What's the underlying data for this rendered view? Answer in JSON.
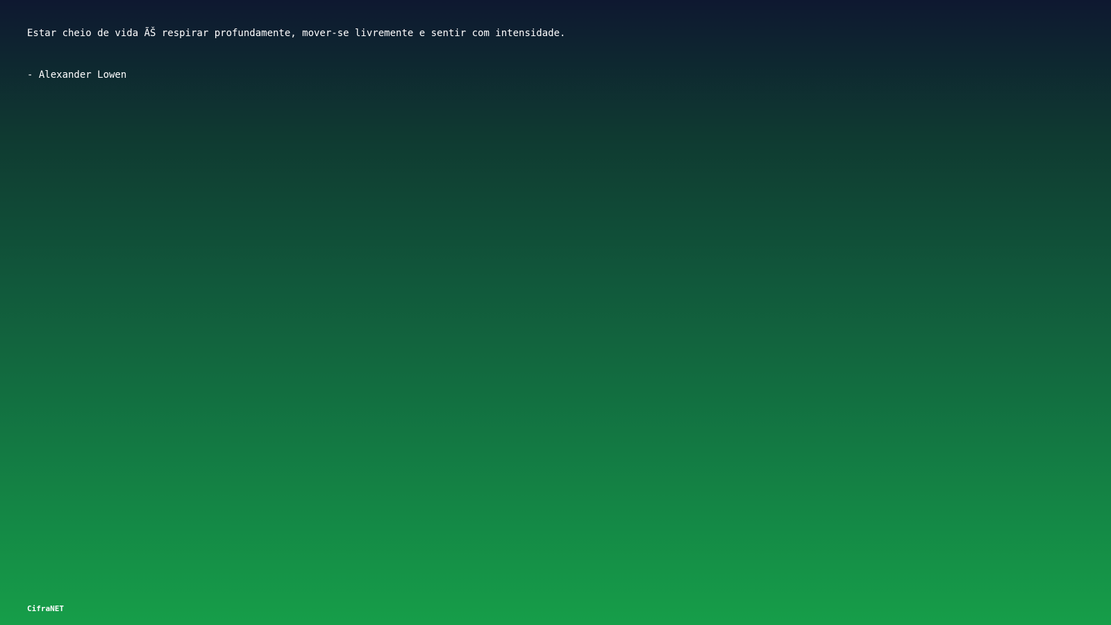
{
  "quote": {
    "text": "Estar cheio de vida ÃŠ respirar profundamente, mover-se livremente e sentir com intensidade.",
    "author": "- Alexander Lowen"
  },
  "brand": {
    "label": "CifraNET"
  },
  "colors": {
    "gradient_top": "#0e1830",
    "gradient_bottom": "#169e49",
    "text": "#ffffff"
  }
}
